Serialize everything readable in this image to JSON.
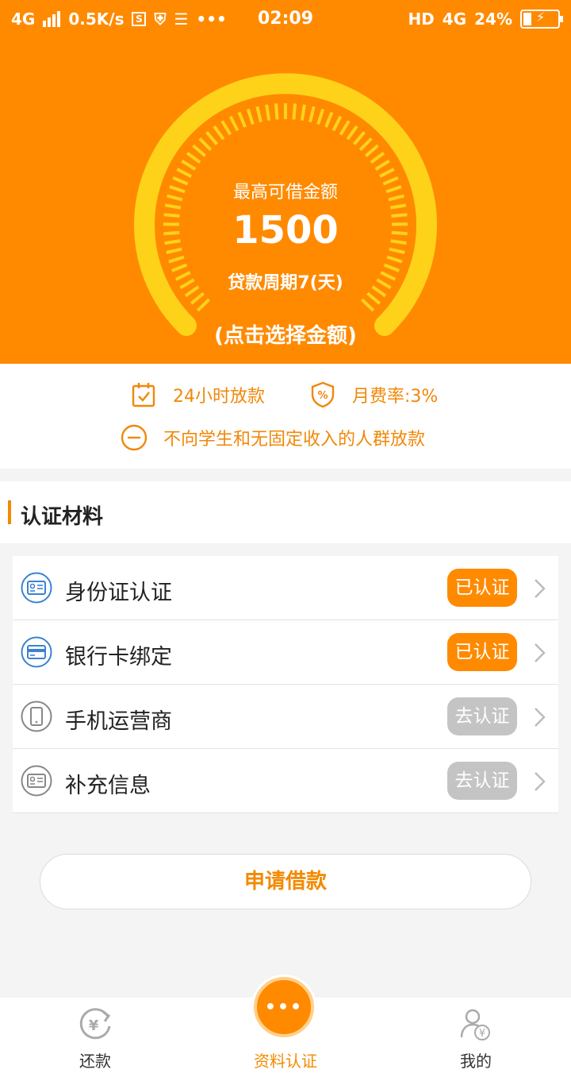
{
  "status_bar": {
    "network": "4G",
    "speed": "0.5K/s",
    "time": "02:09",
    "hd": "HD",
    "network_right": "4G",
    "battery": "24%"
  },
  "hero": {
    "label": "最高可借金额",
    "amount": "1500",
    "period": "贷款周期7(天)",
    "select_hint": "(点击选择金额)"
  },
  "features": {
    "fast_loan": "24小时放款",
    "monthly_rate": "月费率:3%",
    "restriction": "不向学生和无固定收入的人群放款"
  },
  "section": {
    "title": "认证材料"
  },
  "verify_items": [
    {
      "label": "身份证认证",
      "status": "已认证",
      "state": "done",
      "icon": "id-card-icon"
    },
    {
      "label": "银行卡绑定",
      "status": "已认证",
      "state": "done",
      "icon": "bank-card-icon"
    },
    {
      "label": "手机运营商",
      "status": "去认证",
      "state": "todo",
      "icon": "phone-icon"
    },
    {
      "label": "补充信息",
      "status": "去认证",
      "state": "todo",
      "icon": "info-card-icon"
    }
  ],
  "apply_button": "申请借款",
  "tabs": [
    {
      "label": "还款",
      "icon": "repay-icon"
    },
    {
      "label": "资料认证",
      "icon": "more-dots-icon"
    },
    {
      "label": "我的",
      "icon": "user-icon"
    }
  ],
  "colors": {
    "brand": "#ff8a00",
    "gauge": "#ffd21a",
    "todo": "#c4c4c4"
  }
}
